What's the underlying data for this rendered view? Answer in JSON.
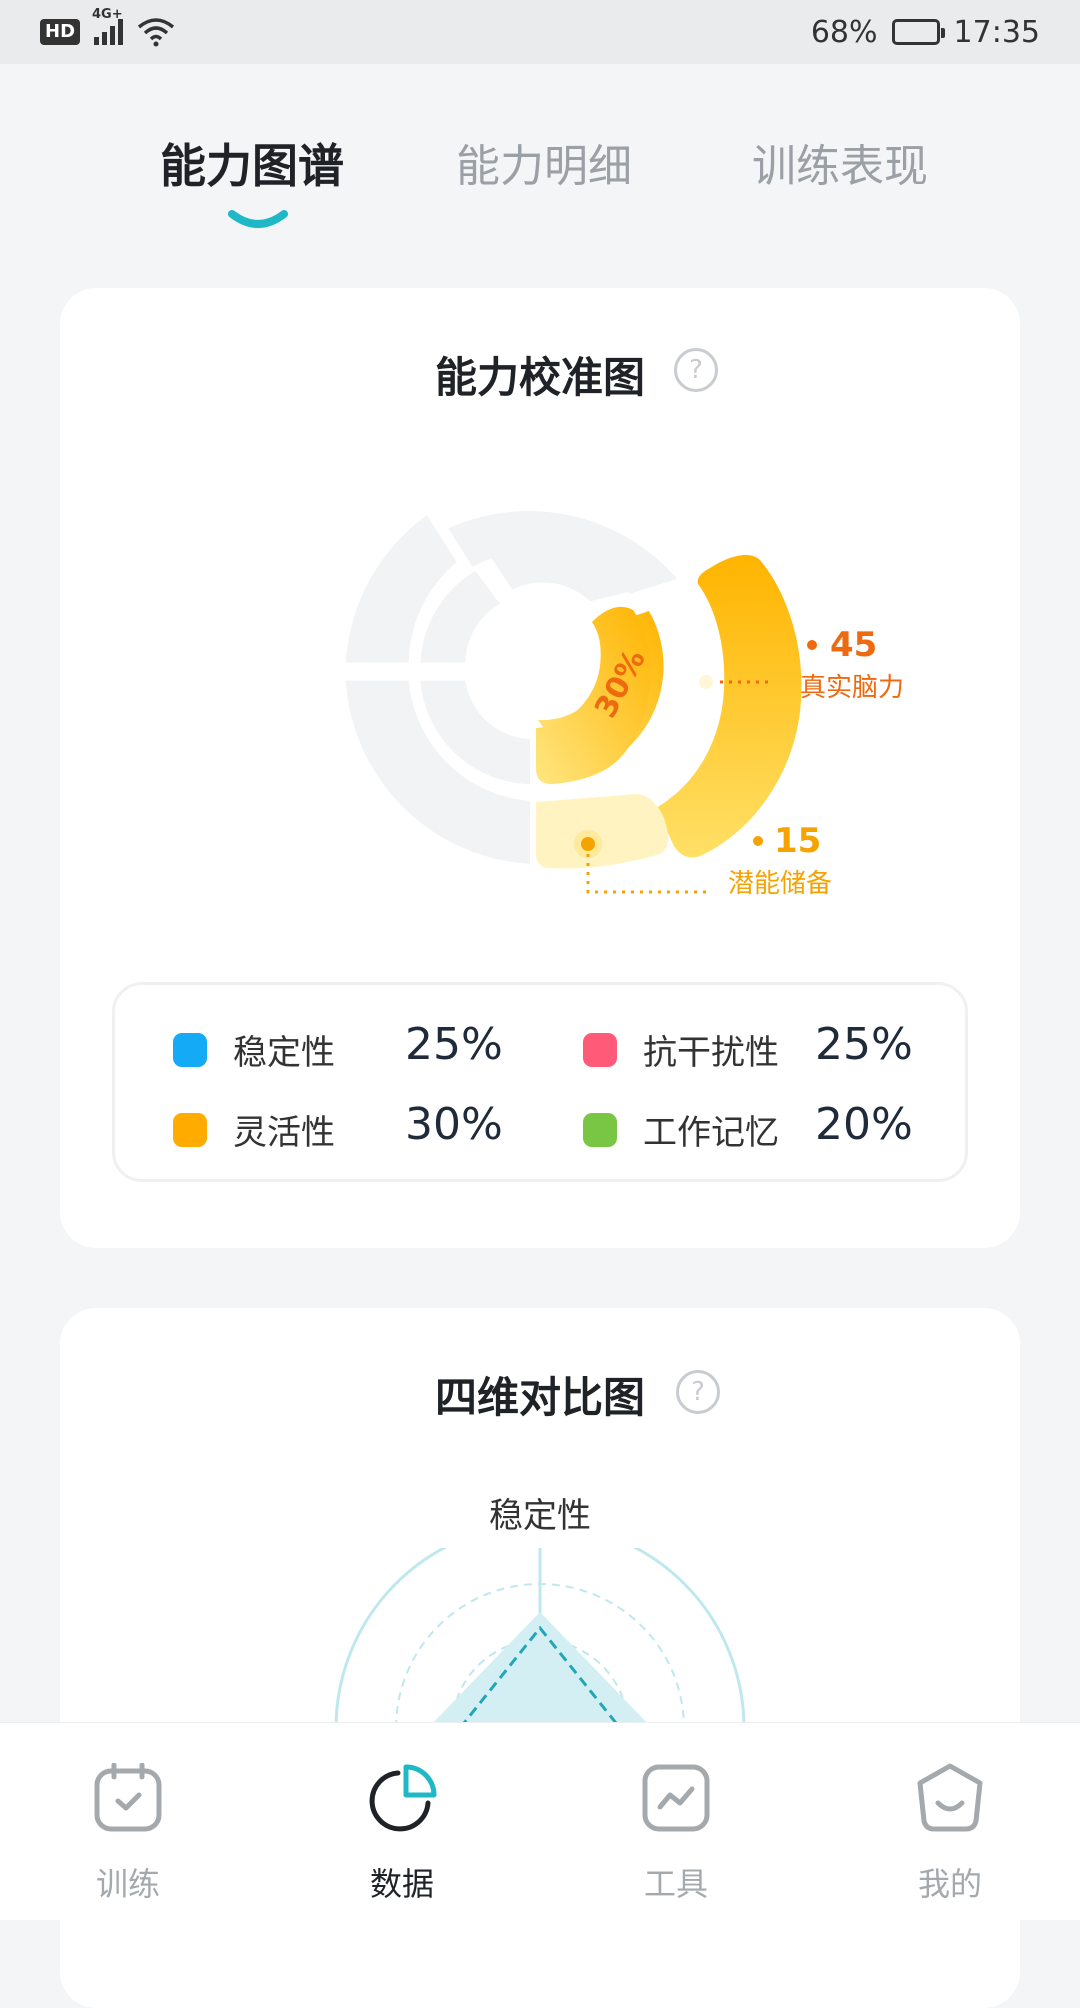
{
  "status_bar": {
    "hd": "HD",
    "network": "4G+",
    "battery": "68%",
    "battery_level": 0.68,
    "time": "17:35"
  },
  "tabs": [
    {
      "label": "能力图谱",
      "active": true
    },
    {
      "label": "能力明细",
      "active": false
    },
    {
      "label": "训练表现",
      "active": false
    }
  ],
  "calibration_card": {
    "title": "能力校准图",
    "help": "?",
    "center_label": "30%",
    "true_value": "45",
    "true_label": "真实脑力",
    "potential_value": "15",
    "potential_label": "潜能储备",
    "colors": {
      "track": "#f1f2f3",
      "gold": "#ffb400",
      "light": "#ffe58a",
      "pale": "#fff3c4",
      "orange": "#ee6a10",
      "amber": "#f5a300"
    }
  },
  "legend": [
    {
      "name": "稳定性",
      "value": "25%",
      "color": "#14aaf5"
    },
    {
      "name": "抗干扰性",
      "value": "25%",
      "color": "#ff5a78"
    },
    {
      "name": "灵活性",
      "value": "30%",
      "color": "#ffab00"
    },
    {
      "name": "工作记忆",
      "value": "20%",
      "color": "#78c644"
    }
  ],
  "comparison_card": {
    "title": "四维对比图",
    "help": "?",
    "axis_top": "稳定性"
  },
  "bottom_nav": [
    {
      "label": "训练",
      "icon": "calendar-check-icon",
      "active": false
    },
    {
      "label": "数据",
      "icon": "pie-chart-icon",
      "active": true
    },
    {
      "label": "工具",
      "icon": "trend-chart-icon",
      "active": false
    },
    {
      "label": "我的",
      "icon": "smile-face-icon",
      "active": false
    }
  ]
}
